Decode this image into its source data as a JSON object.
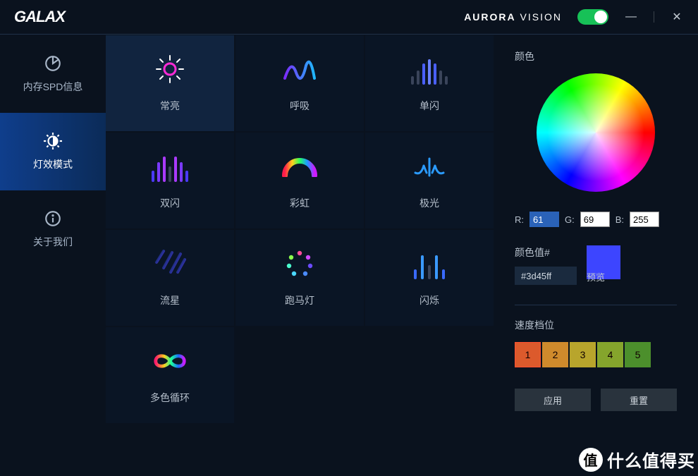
{
  "brand": "GALAX",
  "product": "Aurora Vision",
  "toggle_on": true,
  "sidebar": [
    {
      "id": "spd",
      "label": "内存SPD信息",
      "icon": "pie",
      "active": false
    },
    {
      "id": "light",
      "label": "灯效模式",
      "icon": "contrast",
      "active": true
    },
    {
      "id": "about",
      "label": "关于我们",
      "icon": "info",
      "active": false
    }
  ],
  "modes": [
    {
      "id": "const",
      "label": "常亮",
      "icon": "sun"
    },
    {
      "id": "breath",
      "label": "呼吸",
      "icon": "wave"
    },
    {
      "id": "single",
      "label": "单闪",
      "icon": "bars-center"
    },
    {
      "id": "double",
      "label": "双闪",
      "icon": "bars-twin"
    },
    {
      "id": "rainbow",
      "label": "彩虹",
      "icon": "arc"
    },
    {
      "id": "aurora",
      "label": "极光",
      "icon": "aurora"
    },
    {
      "id": "meteor",
      "label": "流星",
      "icon": "meteor"
    },
    {
      "id": "marquee",
      "label": "跑马灯",
      "icon": "dots-ring"
    },
    {
      "id": "flicker",
      "label": "闪烁",
      "icon": "bars-sparse"
    },
    {
      "id": "cycle",
      "label": "多色循环",
      "icon": "infinity"
    }
  ],
  "selected_mode": "const",
  "color_section": {
    "title": "颜色",
    "r_label": "R:",
    "g_label": "G:",
    "b_label": "B:",
    "r": "61",
    "g": "69",
    "b": "255",
    "hex_label": "颜色值#",
    "hex": "#3d45ff",
    "preview_label": "预览",
    "preview_color": "#3d45ff"
  },
  "speed_section": {
    "title": "速度档位",
    "levels": [
      "1",
      "2",
      "3",
      "4",
      "5"
    ],
    "colors": [
      "#dc5a2c",
      "#cf8a2c",
      "#b8a52c",
      "#85a52c",
      "#4c8f2c"
    ],
    "selected": "1"
  },
  "actions": {
    "apply": "应用",
    "reset": "重置"
  },
  "watermark": {
    "badge": "值",
    "text": "什么值得买"
  }
}
